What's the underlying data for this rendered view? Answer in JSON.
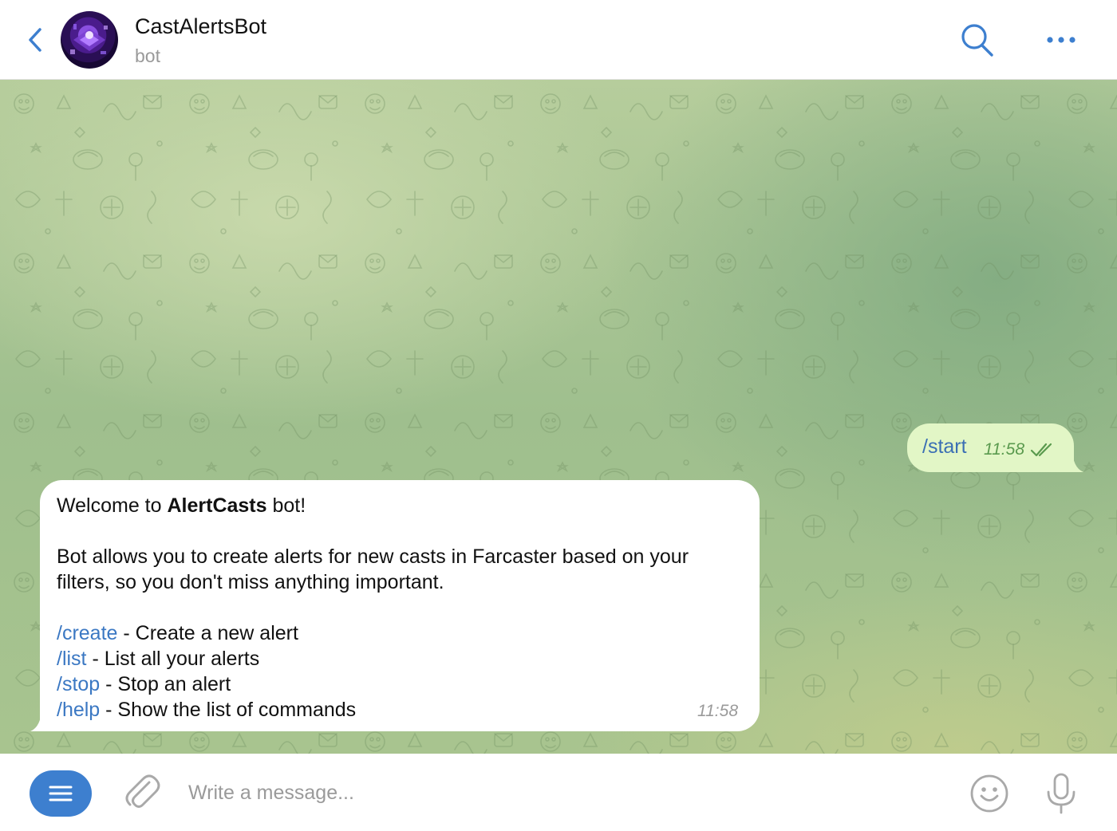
{
  "header": {
    "title": "CastAlertsBot",
    "subtitle": "bot",
    "back_icon": "chevron-left-icon",
    "search_icon": "search-icon",
    "more_icon": "more-horizontal-icon"
  },
  "messages": {
    "outgoing": {
      "command": "/start",
      "time": "11:58",
      "status_icon": "double-check-icon"
    },
    "incoming": {
      "greeting_prefix": "Welcome to ",
      "greeting_name": "AlertCasts",
      "greeting_suffix": " bot!",
      "description_line1": "Bot allows you to create alerts for new casts in Farcaster based on your",
      "description_line2": "filters, so you don't miss anything important.",
      "commands": [
        {
          "command": "/create",
          "description": " - Create a new alert"
        },
        {
          "command": "/list",
          "description": " - List all your alerts"
        },
        {
          "command": "/stop",
          "description": " - Stop an alert"
        },
        {
          "command": "/help",
          "description": " - Show the list of commands"
        }
      ],
      "time": "11:58"
    }
  },
  "composer": {
    "placeholder": "Write a message...",
    "menu_icon": "menu-icon",
    "attach_icon": "paperclip-icon",
    "emoji_icon": "emoji-icon",
    "mic_icon": "microphone-icon"
  },
  "colors": {
    "accent": "#3d7fcf",
    "link": "#3b78c3",
    "outgoing_bubble": "#e2f6c6",
    "incoming_bubble": "#ffffff",
    "chat_background": "#a8c48f"
  }
}
